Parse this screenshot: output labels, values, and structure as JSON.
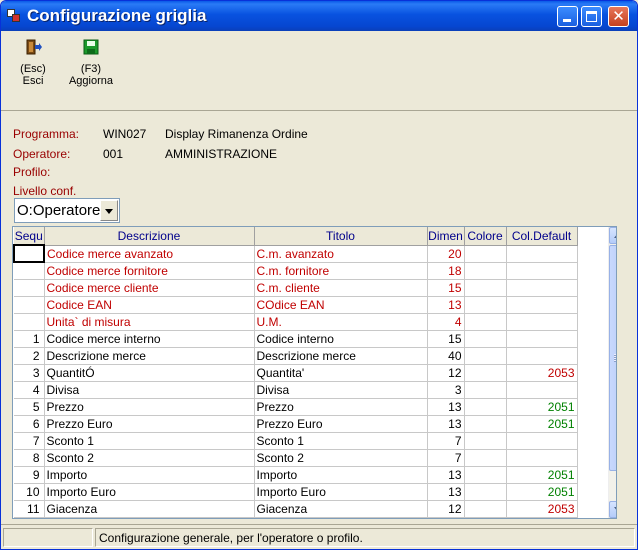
{
  "window": {
    "title": "Configurazione griglia"
  },
  "toolbar": {
    "exit": {
      "key": "(Esc)",
      "label": "Esci",
      "icon": "exit-door-icon"
    },
    "save": {
      "key": "(F3)",
      "label": "Aggiorna",
      "icon": "floppy-disk-icon"
    }
  },
  "info": {
    "programma": {
      "label": "Programma:",
      "code": "WIN027",
      "desc": "Display Rimanenza Ordine"
    },
    "operatore": {
      "label": "Operatore:",
      "code": "001",
      "desc": "AMMINISTRAZIONE"
    },
    "profilo": {
      "label": "Profilo:"
    },
    "livello": {
      "label": "Livello conf.",
      "value": "O:Operatore"
    }
  },
  "grid": {
    "columns": [
      "Sequ",
      "Descrizione",
      "Titolo",
      "Dimen",
      "Colore",
      "Col.Default"
    ],
    "rows": [
      {
        "seq": "",
        "desc": "Codice merce avanzato",
        "title": "C.m. avanzato",
        "dim": "20",
        "color": "",
        "def": "",
        "style": "red"
      },
      {
        "seq": "",
        "desc": "Codice merce fornitore",
        "title": "C.m. fornitore",
        "dim": "18",
        "color": "",
        "def": "",
        "style": "red"
      },
      {
        "seq": "",
        "desc": "Codice merce cliente",
        "title": "C.m. cliente",
        "dim": "15",
        "color": "",
        "def": "",
        "style": "red"
      },
      {
        "seq": "",
        "desc": "Codice EAN",
        "title": "COdice EAN",
        "dim": "13",
        "color": "",
        "def": "",
        "style": "red"
      },
      {
        "seq": "",
        "desc": "Unita` di misura",
        "title": "U.M.",
        "dim": "4",
        "color": "",
        "def": "",
        "style": "red"
      },
      {
        "seq": "1",
        "desc": "Codice merce interno",
        "title": "Codice interno",
        "dim": "15",
        "color": "",
        "def": "",
        "style": "normal"
      },
      {
        "seq": "2",
        "desc": "Descrizione merce",
        "title": "Descrizione merce",
        "dim": "40",
        "color": "",
        "def": "",
        "style": "normal"
      },
      {
        "seq": "3",
        "desc": "QuantitÓ",
        "title": "Quantita'",
        "dim": "12",
        "color": "",
        "def": "2053",
        "style": "normal"
      },
      {
        "seq": "4",
        "desc": "Divisa",
        "title": "Divisa",
        "dim": "3",
        "color": "",
        "def": "",
        "style": "normal"
      },
      {
        "seq": "5",
        "desc": "Prezzo",
        "title": "Prezzo",
        "dim": "13",
        "color": "",
        "def": "2051",
        "style": "normal"
      },
      {
        "seq": "6",
        "desc": "Prezzo Euro",
        "title": "Prezzo Euro",
        "dim": "13",
        "color": "",
        "def": "2051",
        "style": "normal"
      },
      {
        "seq": "7",
        "desc": "Sconto 1",
        "title": "Sconto 1",
        "dim": "7",
        "color": "",
        "def": "",
        "style": "normal"
      },
      {
        "seq": "8",
        "desc": "Sconto 2",
        "title": "Sconto 2",
        "dim": "7",
        "color": "",
        "def": "",
        "style": "normal"
      },
      {
        "seq": "9",
        "desc": "Importo",
        "title": "Importo",
        "dim": "13",
        "color": "",
        "def": "2051",
        "style": "normal"
      },
      {
        "seq": "10",
        "desc": "Importo Euro",
        "title": "Importo Euro",
        "dim": "13",
        "color": "",
        "def": "2051",
        "style": "normal"
      },
      {
        "seq": "11",
        "desc": "Giacenza",
        "title": "Giacenza",
        "dim": "12",
        "color": "",
        "def": "2053",
        "style": "normal"
      }
    ]
  },
  "status": {
    "text": "Configurazione generale, per l'operatore o profilo."
  },
  "colors": {
    "label_red": "#990000",
    "row_red": "#C00000",
    "default_green": "#008000",
    "default_red": "#C00000",
    "header_blue": "#00008B"
  }
}
